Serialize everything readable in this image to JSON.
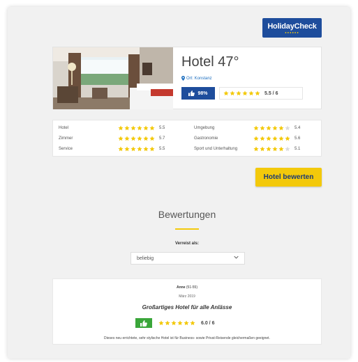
{
  "brand": {
    "name": "HolidayCheck",
    "dots": "●●●●●●",
    "color": "#1e4d9c",
    "accent": "#f3c90b"
  },
  "hotel": {
    "name": "Hotel 47°",
    "location": "Ort: Konstanz",
    "recommend": "98%",
    "rating": "5.5 / 6",
    "rating_stars": 6
  },
  "ratings": {
    "left": [
      {
        "label": "Hotel",
        "value": "5.5",
        "stars": 6
      },
      {
        "label": "Zimmer",
        "value": "5.7",
        "stars": 6
      },
      {
        "label": "Service",
        "value": "5.5",
        "stars": 6
      }
    ],
    "right": [
      {
        "label": "Umgebung",
        "value": "5.4",
        "stars": 5
      },
      {
        "label": "Gastronomie",
        "value": "5.6",
        "stars": 6
      },
      {
        "label": "Sport und Unterhaltung",
        "value": "5.1",
        "stars": 5
      }
    ]
  },
  "cta": {
    "label": "Hotel bewerten"
  },
  "reviews_section": {
    "title": "Bewertungen",
    "filter_label": "Verreist als:",
    "filter_value": "beliebig"
  },
  "review": {
    "author": "Anne",
    "age": "(51-55)",
    "date": "März 2019",
    "title": "Großartiges Hotel für alle Anlässe",
    "score": "6.0 / 6",
    "stars": 6,
    "text": "Dieses neu errichtete, sehr stylische Hotel ist für Business- sowie Privat-Reisende gleichermaßen geeignet."
  }
}
